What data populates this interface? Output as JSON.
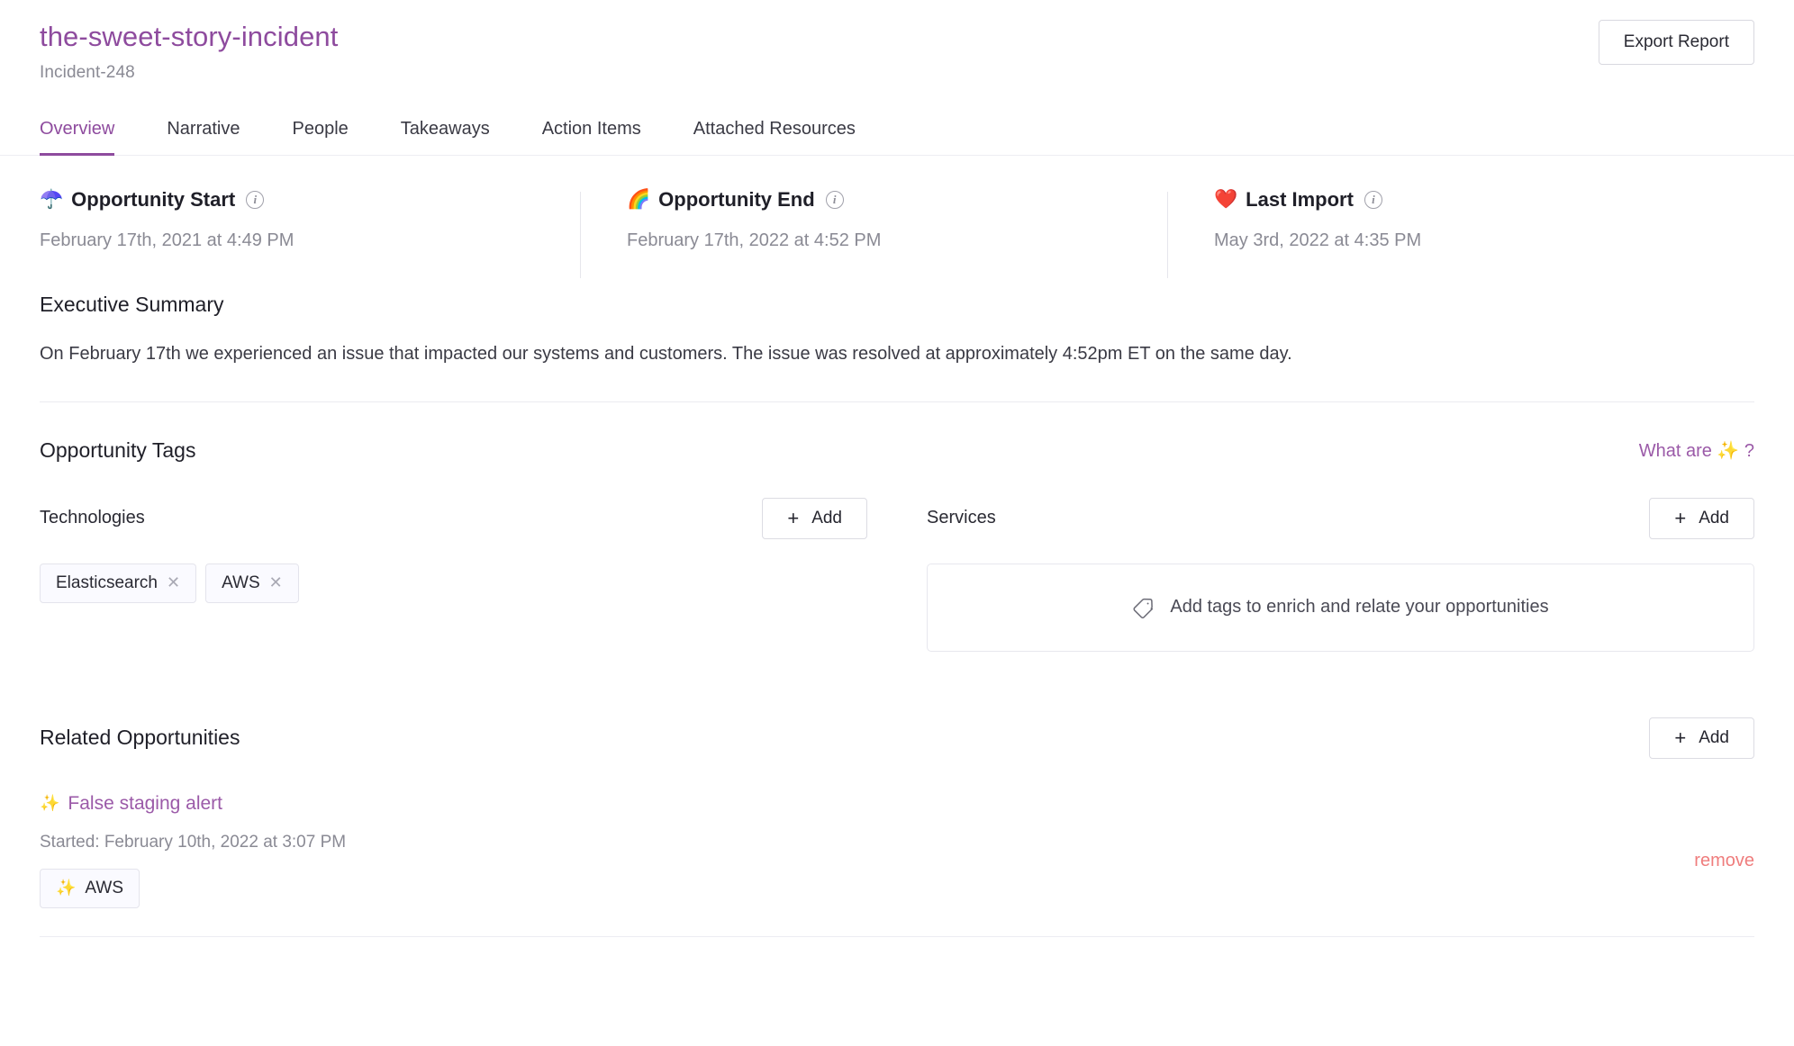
{
  "header": {
    "title": "the-sweet-story-incident",
    "subtitle": "Incident-248",
    "export_label": "Export Report"
  },
  "tabs": [
    {
      "label": "Overview",
      "active": true
    },
    {
      "label": "Narrative",
      "active": false
    },
    {
      "label": "People",
      "active": false
    },
    {
      "label": "Takeaways",
      "active": false
    },
    {
      "label": "Action Items",
      "active": false
    },
    {
      "label": "Attached Resources",
      "active": false
    }
  ],
  "metrics": [
    {
      "emoji": "☂️",
      "emoji_name": "umbrella-with-rain-emoji",
      "label": "Opportunity Start",
      "value": "February 17th, 2021 at 4:49 PM",
      "info": "i"
    },
    {
      "emoji": "🌈",
      "emoji_name": "rainbow-emoji",
      "label": "Opportunity End",
      "value": "February 17th, 2022 at 4:52 PM",
      "info": "i"
    },
    {
      "emoji": "❤️",
      "emoji_name": "red-heart-emoji",
      "label": "Last Import",
      "value": "May 3rd, 2022 at 4:35 PM",
      "info": "i"
    }
  ],
  "executive_summary": {
    "title": "Executive Summary",
    "body": "On February 17th we experienced an issue that impacted our systems and customers. The issue was resolved at approximately 4:52pm ET on the same day."
  },
  "opportunity_tags": {
    "title": "Opportunity Tags",
    "what_are_label": "What are ✨ ?",
    "technologies": {
      "title": "Technologies",
      "add_label": "Add",
      "plus": "+",
      "chips": [
        {
          "label": "Elasticsearch",
          "close": "✕"
        },
        {
          "label": "AWS",
          "close": "✕"
        }
      ]
    },
    "services": {
      "title": "Services",
      "add_label": "Add",
      "plus": "+",
      "empty_message": "Add tags to enrich and relate your opportunities"
    }
  },
  "related_opportunities": {
    "title": "Related Opportunities",
    "add_label": "Add",
    "plus": "+",
    "items": [
      {
        "emoji": "✨",
        "name": "False staging alert",
        "started": "Started: February 10th, 2022 at 3:07 PM",
        "remove_label": "remove",
        "chips": [
          {
            "emoji": "✨",
            "label": "AWS"
          }
        ]
      }
    ]
  },
  "colors": {
    "accent_purple": "#8e4b9e",
    "link_purple": "#9b5aa8",
    "remove_red": "#ef7d7d",
    "muted_gray": "#8a8a94",
    "border": "#e6e6ec"
  }
}
